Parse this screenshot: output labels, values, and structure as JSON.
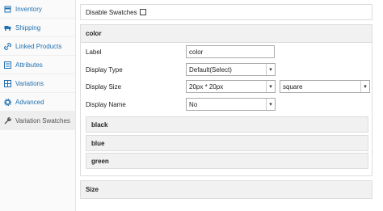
{
  "sidebar": {
    "items": [
      {
        "label": "Inventory",
        "icon": "inventory-icon"
      },
      {
        "label": "Shipping",
        "icon": "truck-icon"
      },
      {
        "label": "Linked Products",
        "icon": "link-icon"
      },
      {
        "label": "Attributes",
        "icon": "list-icon"
      },
      {
        "label": "Variations",
        "icon": "grid-icon"
      },
      {
        "label": "Advanced",
        "icon": "gear-icon"
      },
      {
        "label": "Variation Swatches",
        "icon": "wrench-icon"
      }
    ],
    "active": "Variation Swatches"
  },
  "main": {
    "disable_swatches_label": "Disable Swatches",
    "disable_swatches_checked": false,
    "attribute": {
      "name": "color",
      "label_label": "Label",
      "label_value": "color",
      "display_type_label": "Display Type",
      "display_type_value": "Default(Select)",
      "display_size_label": "Display Size",
      "display_size_value": "20px * 20px",
      "display_shape_value": "square",
      "display_name_label": "Display Name",
      "display_name_value": "No",
      "terms": [
        "black",
        "blue",
        "green"
      ]
    },
    "second_attribute": "Size"
  }
}
